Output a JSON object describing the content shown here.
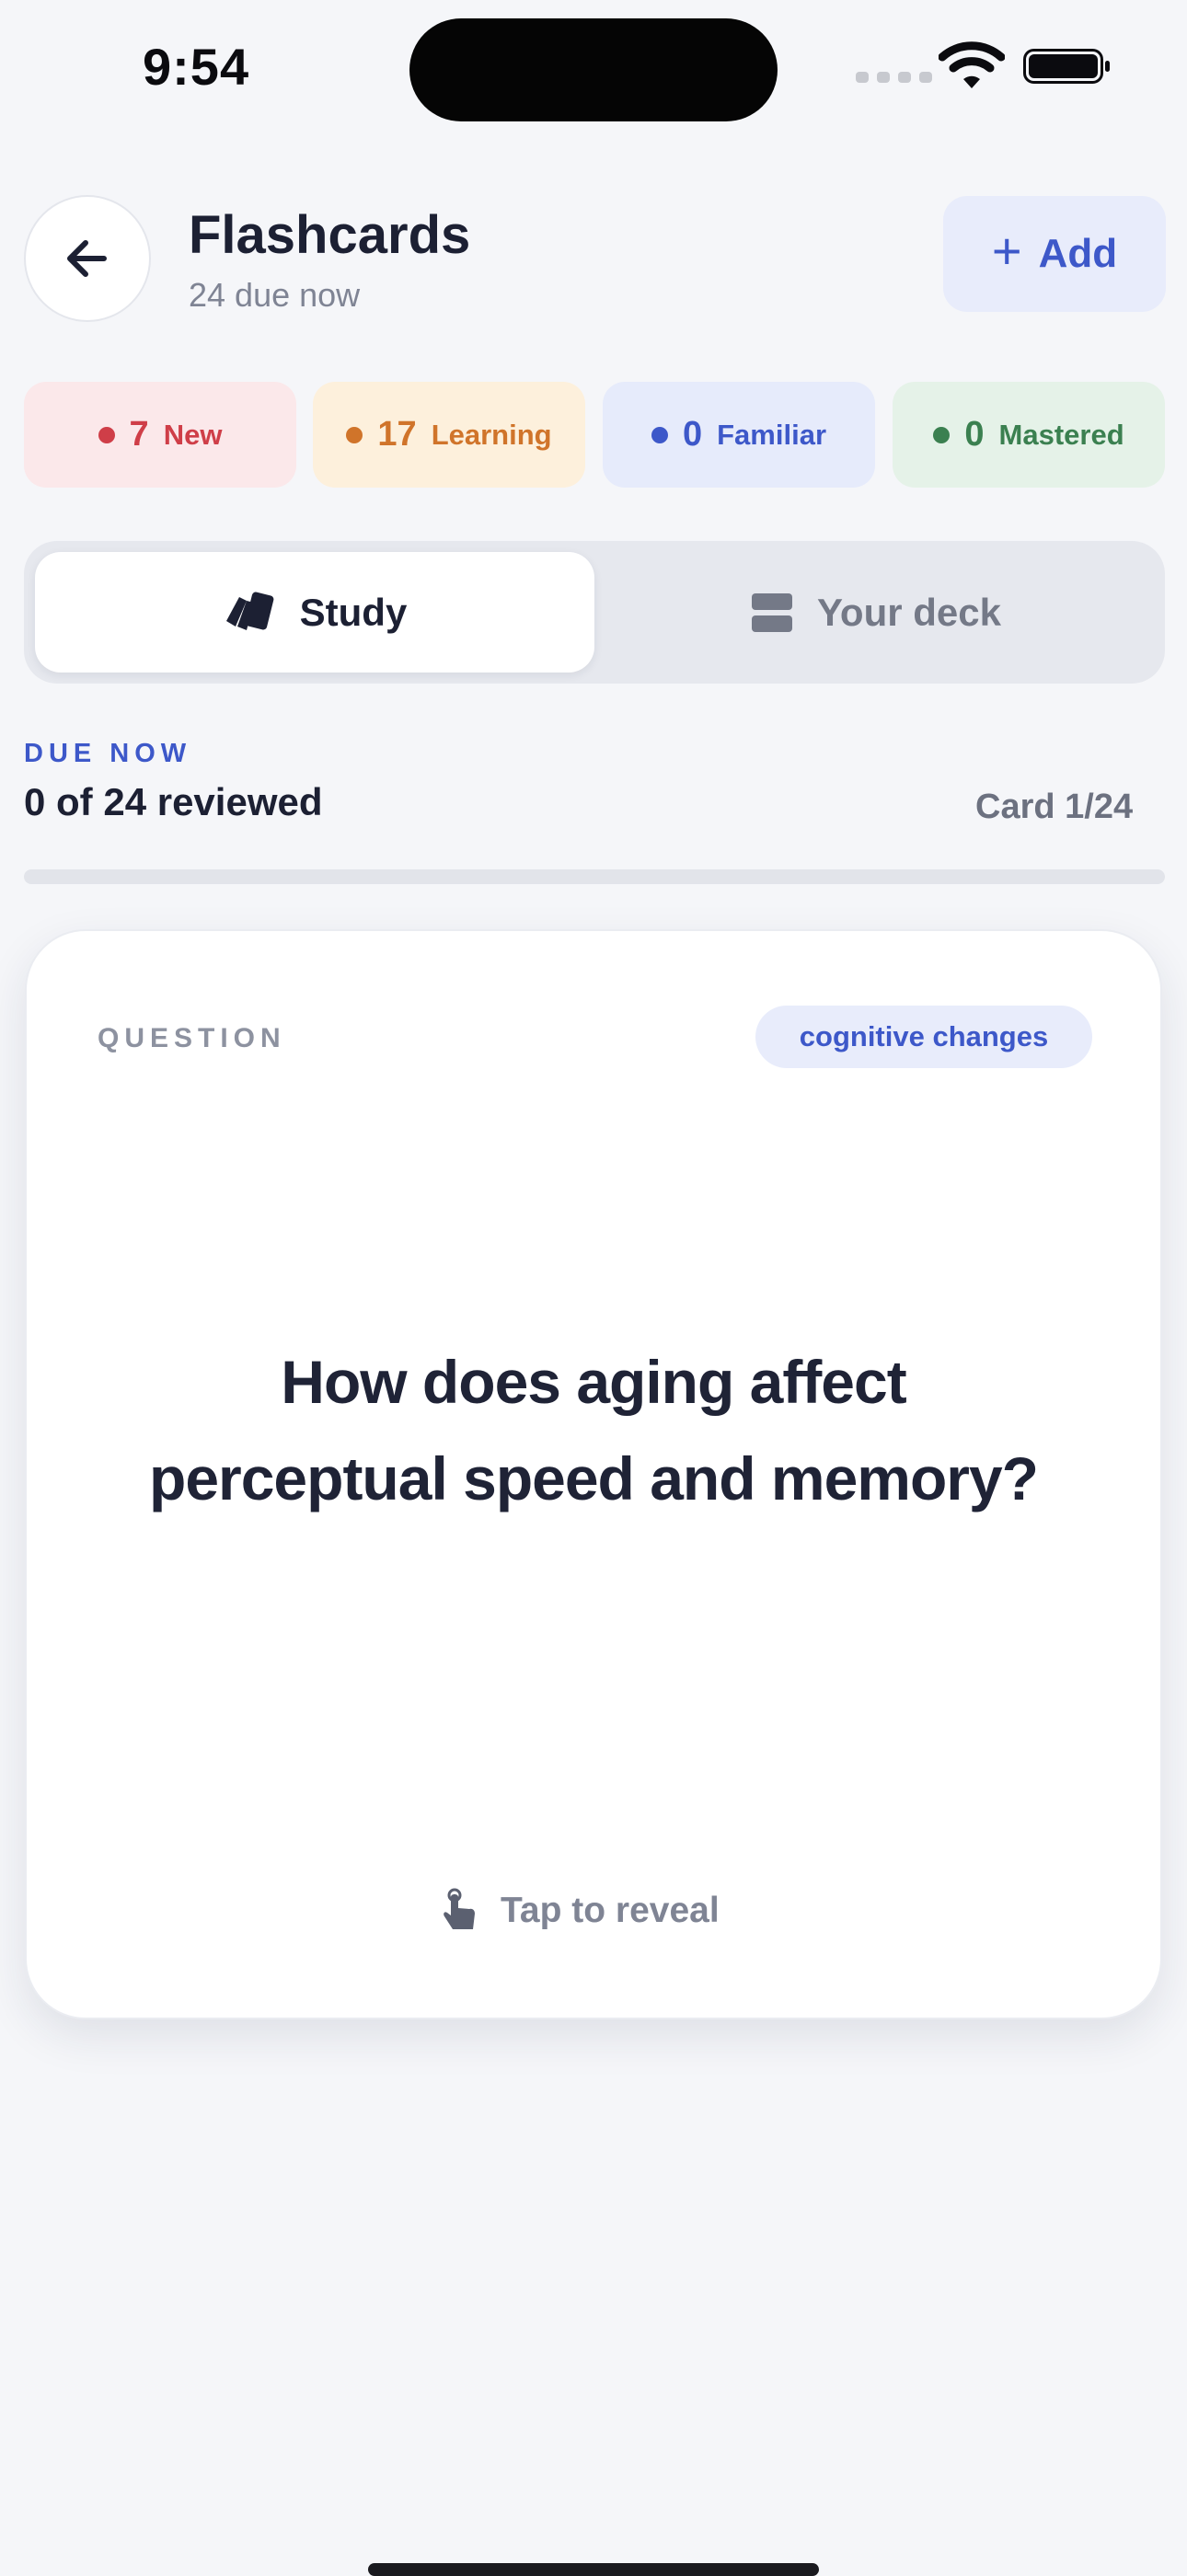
{
  "status_bar": {
    "time": "9:54"
  },
  "header": {
    "title": "Flashcards",
    "subtitle": "24 due now",
    "add_label": "Add"
  },
  "stats": [
    {
      "count": "7",
      "label": "New",
      "color": "#cf3e48"
    },
    {
      "count": "17",
      "label": "Learning",
      "color": "#d0742a"
    },
    {
      "count": "0",
      "label": "Familiar",
      "color": "#3d58c9"
    },
    {
      "count": "0",
      "label": "Mastered",
      "color": "#3b8050"
    }
  ],
  "tabs": {
    "active": "Study",
    "inactive": "Your deck"
  },
  "progress": {
    "section_label": "DUE NOW",
    "reviewed_text": "0 of 24 reviewed",
    "card_position": "Card 1/24",
    "reviewed_fraction": 0
  },
  "card": {
    "side_label": "QUESTION",
    "topic_tag": "cognitive changes",
    "question": "How does aging affect perceptual speed and memory?",
    "hint": "Tap to reveal"
  },
  "colors": {
    "accent": "#3d58c9",
    "background": "#f5f6f9"
  },
  "icons": {
    "back": "arrow-left-icon",
    "add": "plus-icon",
    "study": "cards-icon",
    "deck": "stack-icon",
    "reveal": "tap-hand-icon"
  }
}
